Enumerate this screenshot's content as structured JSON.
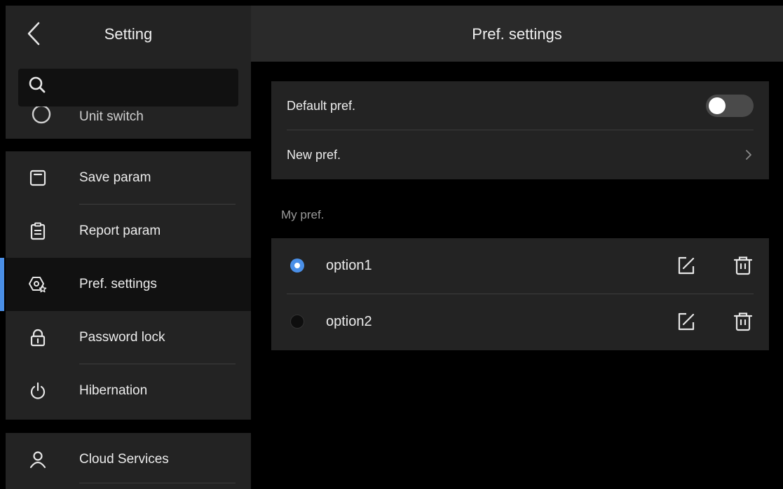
{
  "sidebar": {
    "title": "Setting",
    "search": {
      "placeholder": ""
    },
    "partial_item": {
      "label": "Unit switch",
      "icon": "unit-switch-icon"
    },
    "items": [
      {
        "label": "Save param",
        "icon": "save-icon",
        "active": false
      },
      {
        "label": "Report param",
        "icon": "clipboard-icon",
        "active": false
      },
      {
        "label": "Pref. settings",
        "icon": "pref-settings-icon",
        "active": true
      },
      {
        "label": "Password lock",
        "icon": "lock-icon",
        "active": false
      },
      {
        "label": "Hibernation",
        "icon": "power-icon",
        "active": false
      },
      {
        "label": "Cloud Services",
        "icon": "user-icon",
        "active": false
      }
    ]
  },
  "main": {
    "title": "Pref. settings",
    "default_pref": {
      "label": "Default pref.",
      "enabled": false
    },
    "new_pref": {
      "label": "New pref."
    },
    "section_label": "My pref.",
    "options": [
      {
        "label": "option1",
        "selected": true
      },
      {
        "label": "option2",
        "selected": false
      }
    ]
  },
  "colors": {
    "accent": "#4a8fe7",
    "panel": "#232323",
    "background": "#000000"
  }
}
